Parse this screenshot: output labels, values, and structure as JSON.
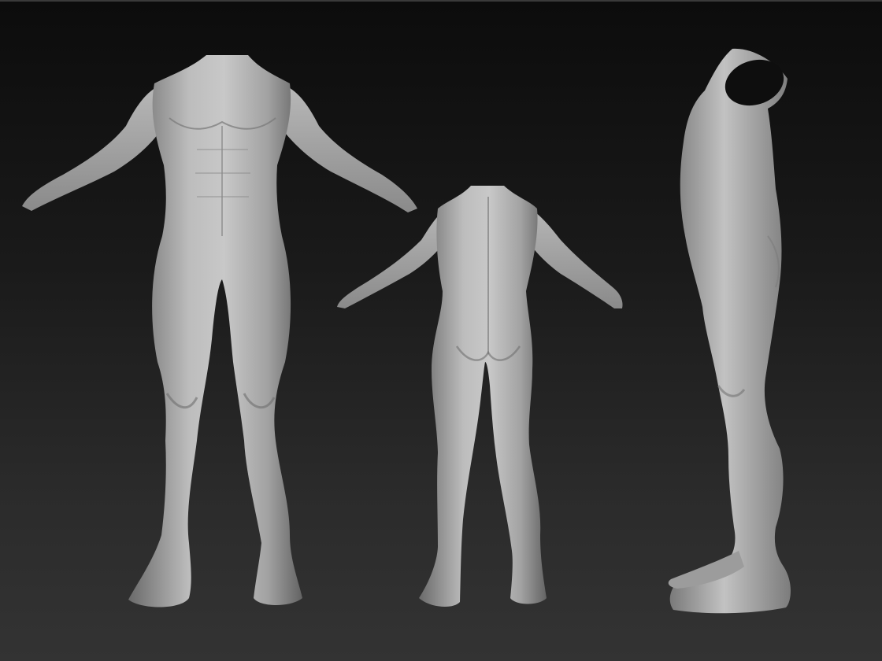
{
  "scene": {
    "views": [
      {
        "id": "front",
        "icon": "front-view-body-icon"
      },
      {
        "id": "back",
        "icon": "back-view-body-icon"
      },
      {
        "id": "side",
        "icon": "side-view-body-icon"
      }
    ],
    "colors": {
      "background_top": "#0c0c0c",
      "background_bottom": "#333333",
      "clay_light": "#c4c4c4",
      "clay_mid": "#9a9a9a",
      "clay_dark": "#5e5e5e"
    }
  }
}
